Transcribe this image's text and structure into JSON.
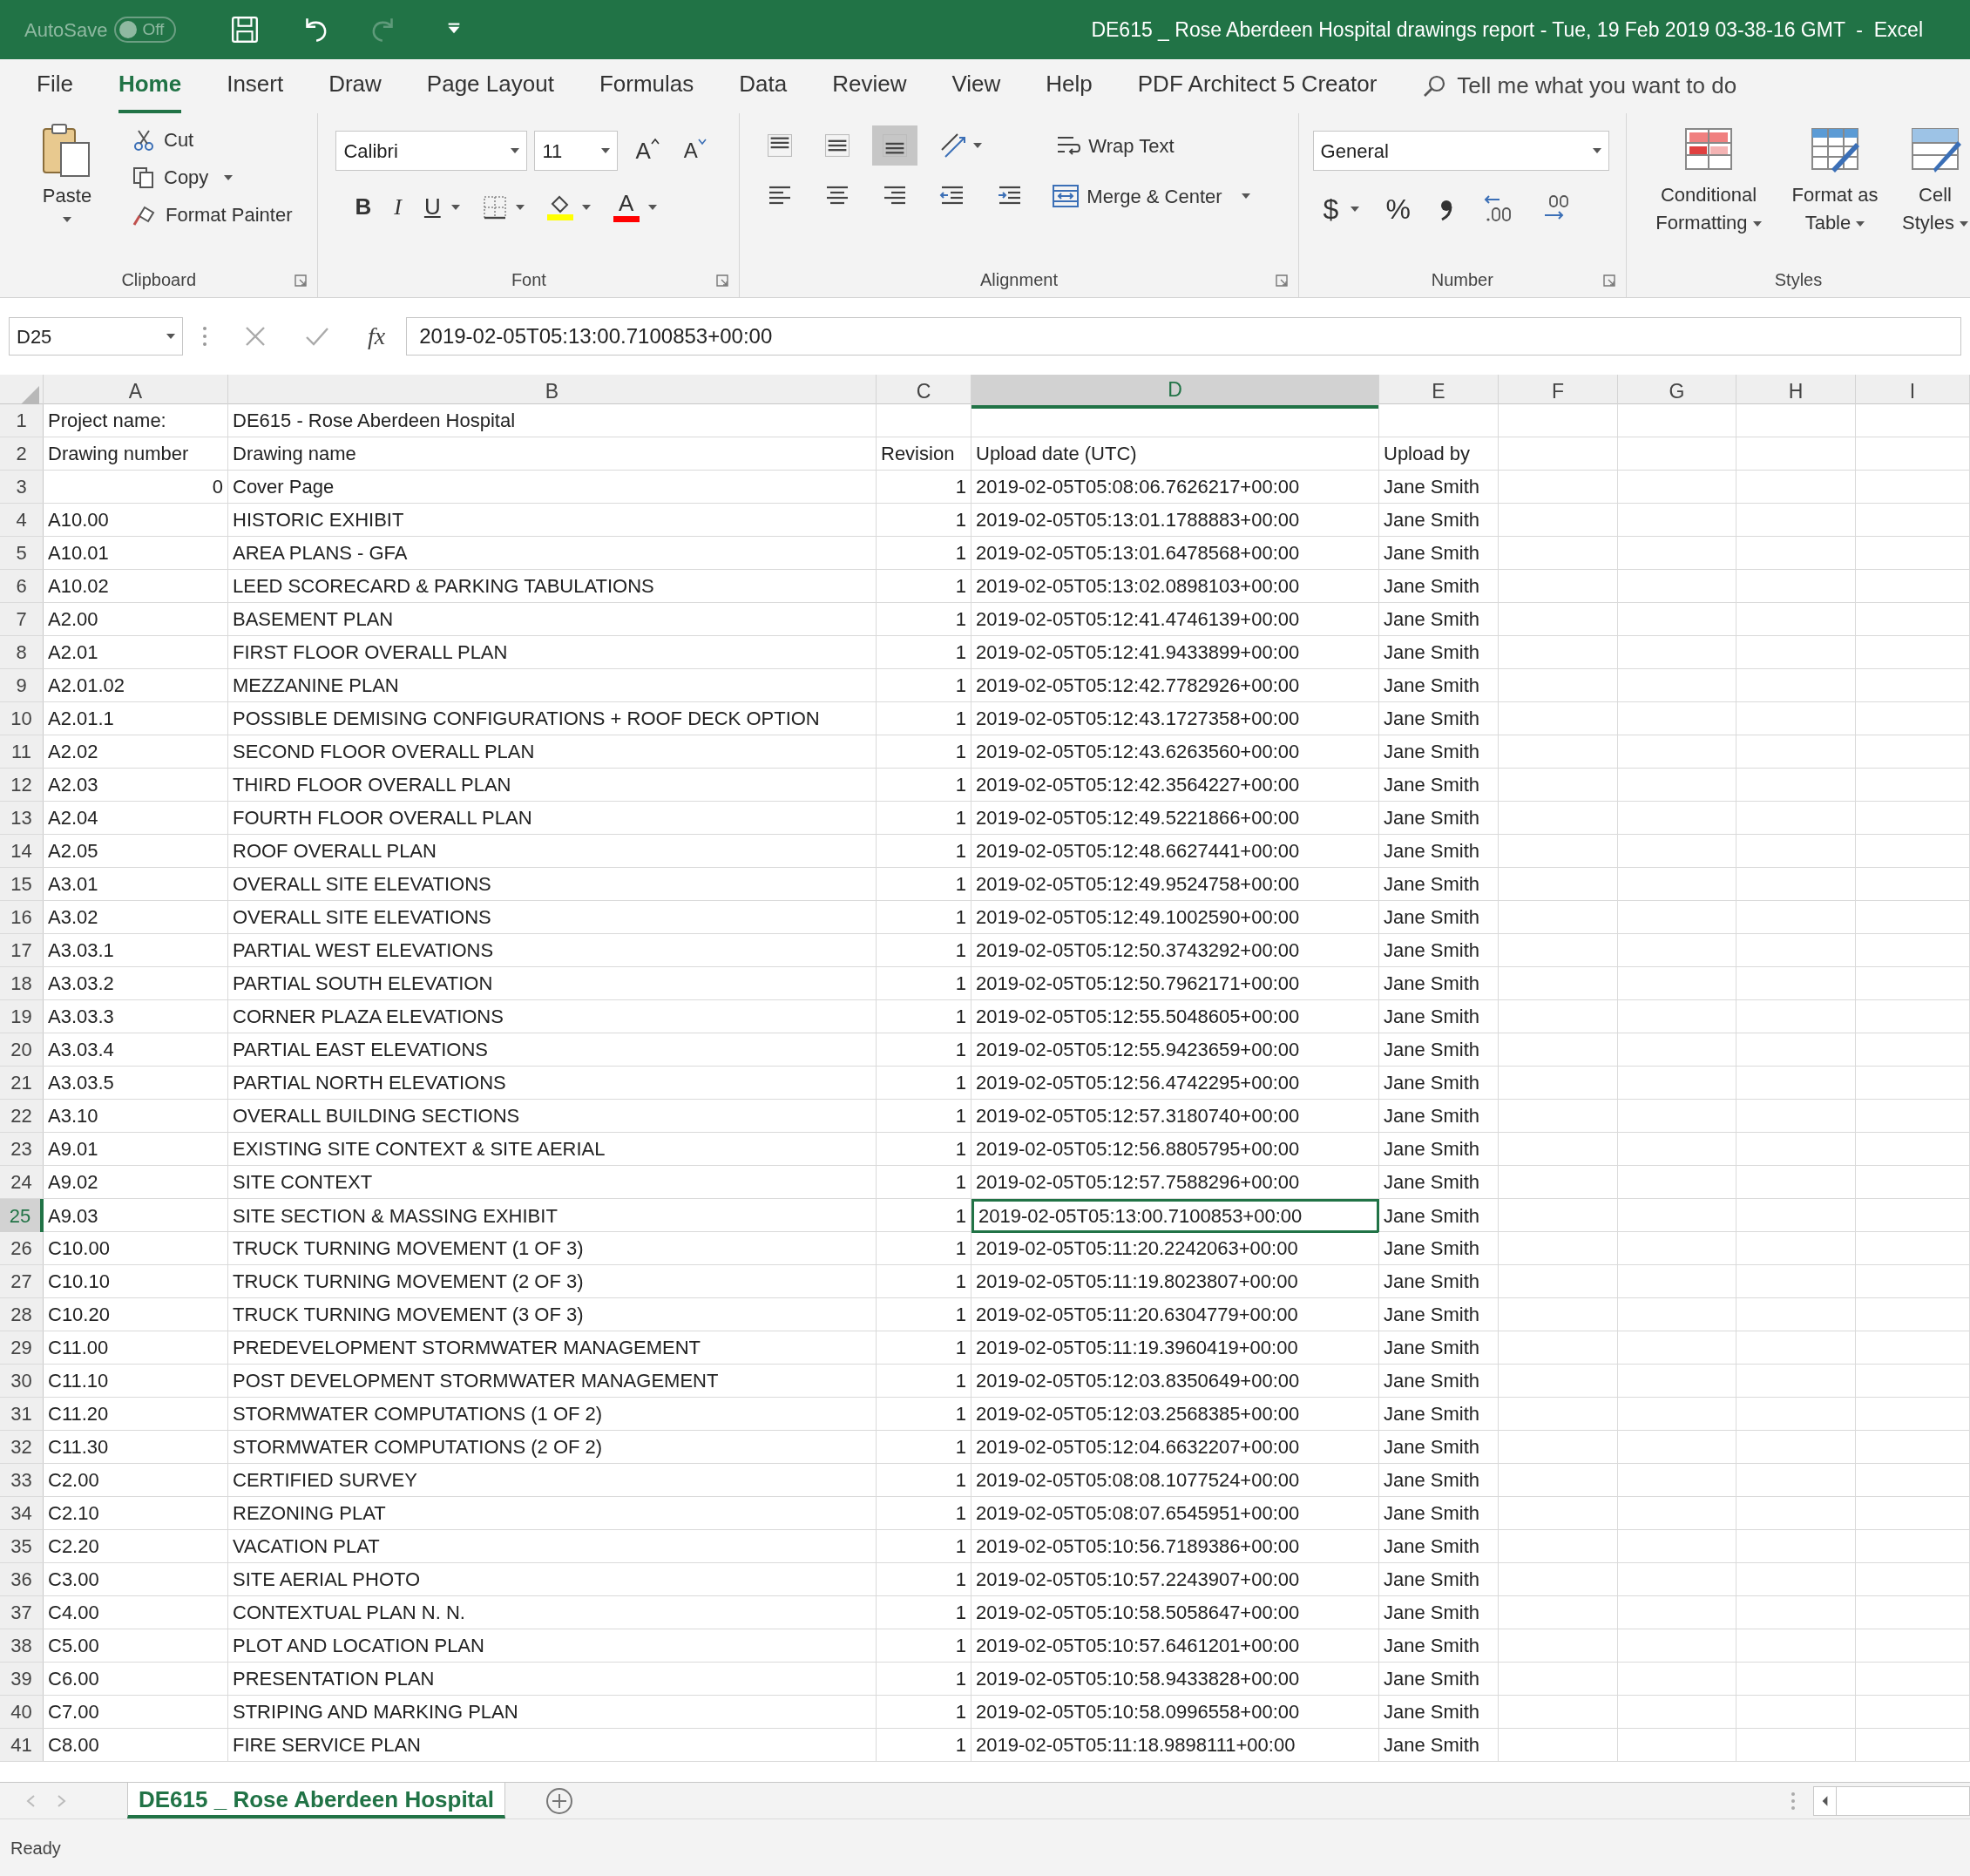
{
  "title_bar": {
    "autosave": {
      "label": "AutoSave",
      "toggle": "Off",
      "on": false
    },
    "quick_access": [
      {
        "kind": "save",
        "disabled": false
      },
      {
        "kind": "undo",
        "disabled": false
      },
      {
        "kind": "redo",
        "disabled": true
      },
      {
        "kind": "customize",
        "disabled": false
      }
    ],
    "title": "DE615 _ Rose Aberdeen Hospital drawings report - Tue, 19 Feb 2019 03-38-16 GMT  -  Excel"
  },
  "menu_tabs": [
    {
      "label": "File",
      "selected": false
    },
    {
      "label": "Home",
      "selected": true
    },
    {
      "label": "Insert",
      "selected": false
    },
    {
      "label": "Draw",
      "selected": false
    },
    {
      "label": "Page Layout",
      "selected": false
    },
    {
      "label": "Formulas",
      "selected": false
    },
    {
      "label": "Data",
      "selected": false
    },
    {
      "label": "Review",
      "selected": false
    },
    {
      "label": "View",
      "selected": false
    },
    {
      "label": "Help",
      "selected": false
    },
    {
      "label": "PDF Architect 5 Creator",
      "selected": false
    }
  ],
  "tell_me": {
    "placeholder": "Tell me what you want to do"
  },
  "ribbon": {
    "clipboard": {
      "paste": "Paste",
      "cut": "Cut",
      "copy": "Copy",
      "format_painter": "Format Painter",
      "label": "Clipboard"
    },
    "font": {
      "font_name": "Calibri",
      "font_size": "11",
      "grow": "A",
      "shrink": "A",
      "bold": "B",
      "italic": "I",
      "underline": "U",
      "font_color": "A",
      "label": "Font"
    },
    "alignment": {
      "vertical": [
        {
          "kind": "top",
          "selected": false
        },
        {
          "kind": "middle",
          "selected": false
        },
        {
          "kind": "bottom",
          "selected": true
        }
      ],
      "wrap_text": "Wrap Text",
      "merge_center": "Merge & Center",
      "label": "Alignment"
    },
    "number": {
      "format": "General",
      "currency": "$",
      "percent": "%",
      "label": "Number"
    },
    "styles": {
      "items": [
        "Conditional Formatting",
        "Format as Table",
        "Cell Styles"
      ],
      "label": "Styles"
    }
  },
  "formula_bar": {
    "name_box": "D25",
    "fx": "fx",
    "formula": "2019-02-05T05:13:00.7100853+00:00"
  },
  "columns": [
    {
      "label": "A",
      "selected": false
    },
    {
      "label": "B",
      "selected": false
    },
    {
      "label": "C",
      "selected": false
    },
    {
      "label": "D",
      "selected": true
    },
    {
      "label": "E",
      "selected": false
    },
    {
      "label": "F",
      "selected": false
    },
    {
      "label": "G",
      "selected": false
    },
    {
      "label": "H",
      "selected": false
    },
    {
      "label": "I",
      "selected": false
    }
  ],
  "rows": [
    {
      "num": "1",
      "kind": "info",
      "selected": false,
      "cells": [
        "Project name:",
        "DE615 - Rose Aberdeen Hospital"
      ]
    },
    {
      "num": "2",
      "kind": "header",
      "selected": false,
      "cells": [
        "Drawing number",
        "Drawing name",
        "Revision",
        "Upload date (UTC)",
        "Upload by"
      ]
    },
    {
      "num": "3",
      "kind": "numeric_record",
      "selected": false,
      "cells": [
        "0",
        "Cover Page",
        "1",
        "2019-02-05T05:08:06.7626217+00:00",
        "Jane Smith"
      ]
    },
    {
      "num": "4",
      "kind": "record",
      "selected": false,
      "cells": [
        "A10.00",
        "HISTORIC EXHIBIT",
        "1",
        "2019-02-05T05:13:01.1788883+00:00",
        "Jane Smith"
      ]
    },
    {
      "num": "5",
      "kind": "record",
      "selected": false,
      "cells": [
        "A10.01",
        "AREA PLANS - GFA",
        "1",
        "2019-02-05T05:13:01.6478568+00:00",
        "Jane Smith"
      ]
    },
    {
      "num": "6",
      "kind": "record",
      "selected": false,
      "cells": [
        "A10.02",
        "LEED SCORECARD & PARKING TABULATIONS",
        "1",
        "2019-02-05T05:13:02.0898103+00:00",
        "Jane Smith"
      ]
    },
    {
      "num": "7",
      "kind": "record",
      "selected": false,
      "cells": [
        "A2.00",
        "BASEMENT PLAN",
        "1",
        "2019-02-05T05:12:41.4746139+00:00",
        "Jane Smith"
      ]
    },
    {
      "num": "8",
      "kind": "record",
      "selected": false,
      "cells": [
        "A2.01",
        "FIRST FLOOR OVERALL PLAN",
        "1",
        "2019-02-05T05:12:41.9433899+00:00",
        "Jane Smith"
      ]
    },
    {
      "num": "9",
      "kind": "record",
      "selected": false,
      "cells": [
        "A2.01.02",
        "MEZZANINE PLAN",
        "1",
        "2019-02-05T05:12:42.7782926+00:00",
        "Jane Smith"
      ]
    },
    {
      "num": "10",
      "kind": "record",
      "selected": false,
      "cells": [
        "A2.01.1",
        "POSSIBLE DEMISING CONFIGURATIONS + ROOF DECK OPTION",
        "1",
        "2019-02-05T05:12:43.1727358+00:00",
        "Jane Smith"
      ]
    },
    {
      "num": "11",
      "kind": "record",
      "selected": false,
      "cells": [
        "A2.02",
        "SECOND FLOOR OVERALL PLAN",
        "1",
        "2019-02-05T05:12:43.6263560+00:00",
        "Jane Smith"
      ]
    },
    {
      "num": "12",
      "kind": "record",
      "selected": false,
      "cells": [
        "A2.03",
        "THIRD FLOOR OVERALL PLAN",
        "1",
        "2019-02-05T05:12:42.3564227+00:00",
        "Jane Smith"
      ]
    },
    {
      "num": "13",
      "kind": "record",
      "selected": false,
      "cells": [
        "A2.04",
        "FOURTH FLOOR OVERALL PLAN",
        "1",
        "2019-02-05T05:12:49.5221866+00:00",
        "Jane Smith"
      ]
    },
    {
      "num": "14",
      "kind": "record",
      "selected": false,
      "cells": [
        "A2.05",
        "ROOF OVERALL PLAN",
        "1",
        "2019-02-05T05:12:48.6627441+00:00",
        "Jane Smith"
      ]
    },
    {
      "num": "15",
      "kind": "record",
      "selected": false,
      "cells": [
        "A3.01",
        "OVERALL SITE ELEVATIONS",
        "1",
        "2019-02-05T05:12:49.9524758+00:00",
        "Jane Smith"
      ]
    },
    {
      "num": "16",
      "kind": "record",
      "selected": false,
      "cells": [
        "A3.02",
        "OVERALL SITE ELEVATIONS",
        "1",
        "2019-02-05T05:12:49.1002590+00:00",
        "Jane Smith"
      ]
    },
    {
      "num": "17",
      "kind": "record",
      "selected": false,
      "cells": [
        "A3.03.1",
        "PARTIAL WEST ELEVATIONS",
        "1",
        "2019-02-05T05:12:50.3743292+00:00",
        "Jane Smith"
      ]
    },
    {
      "num": "18",
      "kind": "record",
      "selected": false,
      "cells": [
        "A3.03.2",
        "PARTIAL SOUTH ELEVATION",
        "1",
        "2019-02-05T05:12:50.7962171+00:00",
        "Jane Smith"
      ]
    },
    {
      "num": "19",
      "kind": "record",
      "selected": false,
      "cells": [
        "A3.03.3",
        "CORNER PLAZA ELEVATIONS",
        "1",
        "2019-02-05T05:12:55.5048605+00:00",
        "Jane Smith"
      ]
    },
    {
      "num": "20",
      "kind": "record",
      "selected": false,
      "cells": [
        "A3.03.4",
        "PARTIAL EAST ELEVATIONS",
        "1",
        "2019-02-05T05:12:55.9423659+00:00",
        "Jane Smith"
      ]
    },
    {
      "num": "21",
      "kind": "record",
      "selected": false,
      "cells": [
        "A3.03.5",
        "PARTIAL NORTH ELEVATIONS",
        "1",
        "2019-02-05T05:12:56.4742295+00:00",
        "Jane Smith"
      ]
    },
    {
      "num": "22",
      "kind": "record",
      "selected": false,
      "cells": [
        "A3.10",
        "OVERALL BUILDING SECTIONS",
        "1",
        "2019-02-05T05:12:57.3180740+00:00",
        "Jane Smith"
      ]
    },
    {
      "num": "23",
      "kind": "record",
      "selected": false,
      "cells": [
        "A9.01",
        "EXISTING SITE CONTEXT & SITE AERIAL",
        "1",
        "2019-02-05T05:12:56.8805795+00:00",
        "Jane Smith"
      ]
    },
    {
      "num": "24",
      "kind": "record",
      "selected": false,
      "cells": [
        "A9.02",
        "SITE CONTEXT",
        "1",
        "2019-02-05T05:12:57.7588296+00:00",
        "Jane Smith"
      ]
    },
    {
      "num": "25",
      "kind": "record",
      "selected": true,
      "cells": [
        "A9.03",
        "SITE SECTION & MASSING EXHIBIT",
        "1",
        "2019-02-05T05:13:00.7100853+00:00",
        "Jane Smith"
      ]
    },
    {
      "num": "26",
      "kind": "record",
      "selected": false,
      "cells": [
        "C10.00",
        "TRUCK TURNING MOVEMENT (1 OF 3)",
        "1",
        "2019-02-05T05:11:20.2242063+00:00",
        "Jane Smith"
      ]
    },
    {
      "num": "27",
      "kind": "record",
      "selected": false,
      "cells": [
        "C10.10",
        "TRUCK TURNING MOVEMENT (2 OF 3)",
        "1",
        "2019-02-05T05:11:19.8023807+00:00",
        "Jane Smith"
      ]
    },
    {
      "num": "28",
      "kind": "record",
      "selected": false,
      "cells": [
        "C10.20",
        "TRUCK TURNING MOVEMENT (3 OF 3)",
        "1",
        "2019-02-05T05:11:20.6304779+00:00",
        "Jane Smith"
      ]
    },
    {
      "num": "29",
      "kind": "record",
      "selected": false,
      "cells": [
        "C11.00",
        "PREDEVELOPMENT STORMWATER MANAGEMENT",
        "1",
        "2019-02-05T05:11:19.3960419+00:00",
        "Jane Smith"
      ]
    },
    {
      "num": "30",
      "kind": "record",
      "selected": false,
      "cells": [
        "C11.10",
        "POST DEVELOPMENT STORMWATER MANAGEMENT",
        "1",
        "2019-02-05T05:12:03.8350649+00:00",
        "Jane Smith"
      ]
    },
    {
      "num": "31",
      "kind": "record",
      "selected": false,
      "cells": [
        "C11.20",
        "STORMWATER COMPUTATIONS (1 OF 2)",
        "1",
        "2019-02-05T05:12:03.2568385+00:00",
        "Jane Smith"
      ]
    },
    {
      "num": "32",
      "kind": "record",
      "selected": false,
      "cells": [
        "C11.30",
        "STORMWATER COMPUTATIONS (2 OF 2)",
        "1",
        "2019-02-05T05:12:04.6632207+00:00",
        "Jane Smith"
      ]
    },
    {
      "num": "33",
      "kind": "record",
      "selected": false,
      "cells": [
        "C2.00",
        "CERTIFIED SURVEY",
        "1",
        "2019-02-05T05:08:08.1077524+00:00",
        "Jane Smith"
      ]
    },
    {
      "num": "34",
      "kind": "record",
      "selected": false,
      "cells": [
        "C2.10",
        "REZONING PLAT",
        "1",
        "2019-02-05T05:08:07.6545951+00:00",
        "Jane Smith"
      ]
    },
    {
      "num": "35",
      "kind": "record",
      "selected": false,
      "cells": [
        "C2.20",
        "VACATION PLAT",
        "1",
        "2019-02-05T05:10:56.7189386+00:00",
        "Jane Smith"
      ]
    },
    {
      "num": "36",
      "kind": "record",
      "selected": false,
      "cells": [
        "C3.00",
        "SITE AERIAL PHOTO",
        "1",
        "2019-02-05T05:10:57.2243907+00:00",
        "Jane Smith"
      ]
    },
    {
      "num": "37",
      "kind": "record",
      "selected": false,
      "cells": [
        "C4.00",
        "CONTEXTUAL PLAN N. N.",
        "1",
        "2019-02-05T05:10:58.5058647+00:00",
        "Jane Smith"
      ]
    },
    {
      "num": "38",
      "kind": "record",
      "selected": false,
      "cells": [
        "C5.00",
        "PLOT AND LOCATION PLAN",
        "1",
        "2019-02-05T05:10:57.6461201+00:00",
        "Jane Smith"
      ]
    },
    {
      "num": "39",
      "kind": "record",
      "selected": false,
      "cells": [
        "C6.00",
        "PRESENTATION PLAN",
        "1",
        "2019-02-05T05:10:58.9433828+00:00",
        "Jane Smith"
      ]
    },
    {
      "num": "40",
      "kind": "record",
      "selected": false,
      "cells": [
        "C7.00",
        "STRIPING AND MARKING PLAN",
        "1",
        "2019-02-05T05:10:58.0996558+00:00",
        "Jane Smith"
      ]
    },
    {
      "num": "41",
      "kind": "record",
      "selected": false,
      "cells": [
        "C8.00",
        "FIRE SERVICE PLAN",
        "1",
        "2019-02-05T05:11:18.9898111+00:00",
        "Jane Smith"
      ]
    }
  ],
  "sheet_tabs": [
    {
      "label": "DE615 _ Rose Aberdeen Hospital",
      "selected": true
    }
  ],
  "status_bar": {
    "status": "Ready"
  }
}
